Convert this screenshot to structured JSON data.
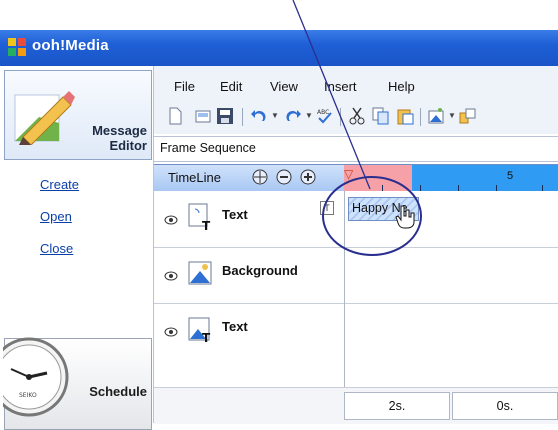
{
  "window": {
    "title": "ooh!Media"
  },
  "sidebar": {
    "message_editor": {
      "line1": "Message",
      "line2": "Editor"
    },
    "links": [
      {
        "label": "Create"
      },
      {
        "label": "Open"
      },
      {
        "label": "Close"
      }
    ],
    "schedule": {
      "label": "Schedule"
    }
  },
  "menu": {
    "items": [
      "File",
      "Edit",
      "View",
      "Insert",
      "Help"
    ]
  },
  "toolbar": {
    "icons": [
      "new-file-icon",
      "open-icon",
      "save-icon",
      "undo-icon",
      "redo-icon",
      "spell-check-icon",
      "cut-icon",
      "copy-icon",
      "paste-icon",
      "insert-image-icon",
      "more-icon"
    ]
  },
  "frame_sequence": {
    "label": "Frame Sequence"
  },
  "timeline": {
    "label": "TimeLine",
    "controls": [
      "move-icon",
      "zoom-out-icon",
      "zoom-in-icon"
    ],
    "ruler_number": "5",
    "layers": [
      {
        "name": "Text",
        "icon": "text-layer-icon",
        "clip_text": "Happy Ne",
        "badge": "T"
      },
      {
        "name": "Background",
        "icon": "image-layer-icon"
      },
      {
        "name": "Text",
        "icon": "text-layer-icon"
      }
    ],
    "footer": {
      "duration": "2s.",
      "offset": "0s."
    }
  },
  "colors": {
    "titlebar": "#1f5fd6",
    "ruler": "#2f9bf2",
    "ruler_highlight": "#f6a1a8",
    "annotation": "#2a2f8f"
  }
}
